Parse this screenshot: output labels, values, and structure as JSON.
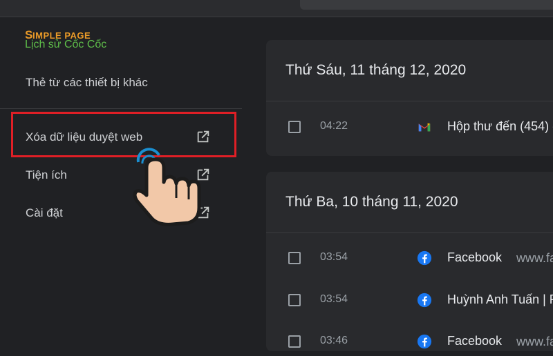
{
  "watermark": {
    "text": "IMPLE PAGE",
    "initial": "S"
  },
  "sidebar": {
    "title": "Lịch sử Cốc Cốc",
    "items": [
      {
        "label": "Thẻ từ các thiết bị khác"
      },
      {
        "label": "Xóa dữ liệu duyệt web",
        "icon": "open-in-new-icon"
      },
      {
        "label": "Tiện ích",
        "icon": "open-in-new-icon"
      },
      {
        "label": "Cài đặt",
        "icon": "open-in-new-icon"
      }
    ]
  },
  "groups": [
    {
      "date": "Thứ Sáu, 11 tháng 12, 2020",
      "entries": [
        {
          "time": "04:22",
          "icon": "gmail-icon",
          "title": "Hộp thư đến (454) -"
        }
      ]
    },
    {
      "date": "Thứ Ba, 10 tháng 11, 2020",
      "entries": [
        {
          "time": "03:54",
          "icon": "facebook-icon",
          "title": "Facebook",
          "url": "www.fa"
        },
        {
          "time": "03:54",
          "icon": "facebook-icon",
          "title": "Huỳnh Anh Tuấn | F"
        },
        {
          "time": "03:46",
          "icon": "facebook-icon",
          "title": "Facebook",
          "url": "www.fa"
        }
      ]
    }
  ],
  "colors": {
    "background": "#202124",
    "card": "#292a2d",
    "highlight": "#e01f26",
    "title_green": "#5fbf4a",
    "logo_orange": "#e99a28",
    "facebook": "#1877f2"
  }
}
